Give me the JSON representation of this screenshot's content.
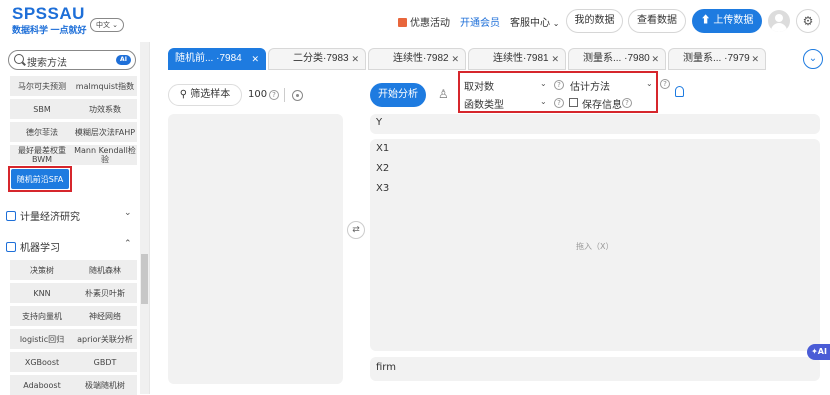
{
  "header": {
    "logo": "SPSSAU",
    "slogan": "数据科学 一点就好",
    "language": "中文",
    "promo": "优惠活动",
    "vip": "开通会员",
    "service": "客服中心",
    "my_data": "我的数据",
    "view_data": "查看数据",
    "upload": "上传数据"
  },
  "sidebar": {
    "search_placeholder": "搜索方法",
    "ai_badge": "AI",
    "methods_top": [
      "马尔可夫预测",
      "malmquist指数",
      "SBM",
      "功效系数",
      "德尔菲法",
      "模糊层次法FAHP",
      "最好最差权重BWM",
      "Mann Kendall检验"
    ],
    "active_method": "随机前沿SFA",
    "section_econometrics": "计量经济研究",
    "section_ml": "机器学习",
    "methods_ml": [
      "决策树",
      "随机森林",
      "KNN",
      "朴素贝叶斯",
      "支持向量机",
      "神经网络",
      "logistic回归",
      "aprior关联分析",
      "XGBoost",
      "GBDT",
      "Adaboost",
      "极端随机树"
    ]
  },
  "tabs": [
    {
      "label": "随机前... ·7984",
      "active": true
    },
    {
      "label": "二分类·7983",
      "active": false
    },
    {
      "label": "连续性·7982",
      "active": false
    },
    {
      "label": "连续性·7981",
      "active": false
    },
    {
      "label": "测量系... ·7980",
      "active": false
    },
    {
      "label": "测量系... ·7979",
      "active": false
    }
  ],
  "toolbar": {
    "filter_label": "筛选样本",
    "sample_count": "100",
    "start_label": "开始分析",
    "option_log": "取对数",
    "option_estimate": "估计方法",
    "option_func": "函数类型",
    "option_save": "保存信息"
  },
  "variables": {
    "y_label": "Y",
    "x_items": [
      "X1",
      "X2",
      "X3"
    ],
    "x_placeholder": "拖入（X）",
    "firm_label": "firm"
  },
  "ai_bubble": "AI"
}
